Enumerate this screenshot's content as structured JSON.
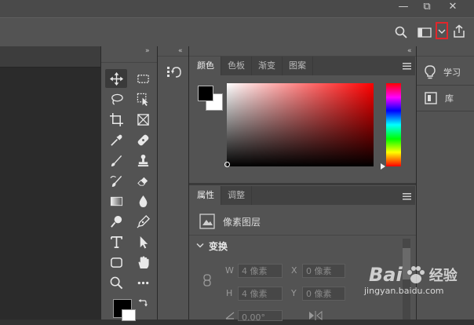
{
  "window": {
    "minimize": "—",
    "restore": "⧉",
    "close": "✕"
  },
  "toolbar": {
    "collapse_glyph": "»"
  },
  "panels": {
    "collapse_glyph": "«",
    "color_tabs": [
      "颜色",
      "色板",
      "渐变",
      "图案"
    ],
    "props_tabs": [
      "属性",
      "调整"
    ],
    "layer_type": "像素图层",
    "section": "变换",
    "fields": {
      "w_label": "W",
      "w_value": "4 像素",
      "x_label": "X",
      "x_value": "0 像素",
      "h_label": "H",
      "h_value": "4 像素",
      "y_label": "Y",
      "y_value": "0 像素",
      "angle_value": "0.00°"
    }
  },
  "right": {
    "learn": "学习",
    "library": "库"
  },
  "watermark": {
    "brand": "Bai",
    "brand2": "经验",
    "url": "jingyan.baidu.com"
  },
  "colors": {
    "highlight": "#e2262b",
    "swatch_red": "#ff2a2a"
  }
}
